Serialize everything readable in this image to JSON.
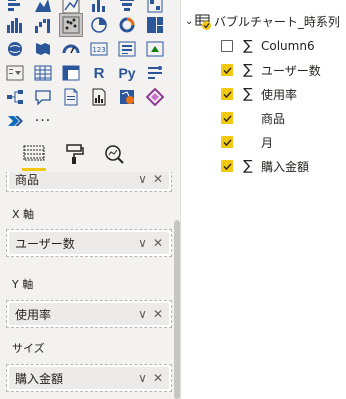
{
  "visualizations": {
    "icons": [
      [
        "stacked-bar-chart-icon",
        "mountain-area-chart-icon",
        "line-chart-icon",
        "stacked-column-icon",
        "funnel-chart-icon",
        "waterfall-chart-icon"
      ],
      [
        "ribbon-chart-icon",
        "waterfall-icon",
        "scatter-chart-icon",
        "pie-chart-icon",
        "donut-chart-icon",
        "treemap-icon"
      ],
      [
        "map-icon",
        "filled-map-icon",
        "gauge-icon",
        "card-icon",
        "multi-row-card-icon",
        "kpi-icon"
      ],
      [
        "slicer-icon",
        "table-icon",
        "matrix-icon",
        "r-script-icon",
        "python-visual-icon",
        "key-influencers-icon"
      ],
      [
        "decomposition-tree-icon",
        "qa-icon",
        "smart-narrative-icon",
        "paginated-report-icon",
        "arcgis-map-icon",
        "power-apps-icon"
      ],
      [
        "power-automate-icon",
        "more-visuals-icon"
      ]
    ],
    "r_label": "R",
    "py_label": "Py",
    "more_label": "···",
    "selected": "scatter-chart-icon"
  },
  "tabs": [
    "fields-tab",
    "format-tab",
    "analytics-tab"
  ],
  "wells": {
    "top_value": "商品",
    "x_label": "X 軸",
    "x_value": "ユーザー数",
    "y_label": "Y 軸",
    "y_value": "使用率",
    "size_label": "サイズ",
    "size_value": "購入金額",
    "chevron": "∨",
    "remove": "✕"
  },
  "fields": {
    "table_name": "バブルチャート_時系列",
    "items": [
      {
        "name": "Column6",
        "checked": false,
        "sigma": true
      },
      {
        "name": "ユーザー数",
        "checked": true,
        "sigma": true
      },
      {
        "name": "使用率",
        "checked": true,
        "sigma": true
      },
      {
        "name": "商品",
        "checked": true,
        "sigma": false
      },
      {
        "name": "月",
        "checked": true,
        "sigma": false
      },
      {
        "name": "購入金額",
        "checked": true,
        "sigma": true
      }
    ],
    "sigma_glyph": "∑"
  },
  "colors": {
    "accent": "#f2c811",
    "icon_blue": "#2b579a",
    "icon_teal": "#0f6cbd",
    "icon_orange": "#e8711a",
    "icon_purple": "#8e3a95"
  }
}
